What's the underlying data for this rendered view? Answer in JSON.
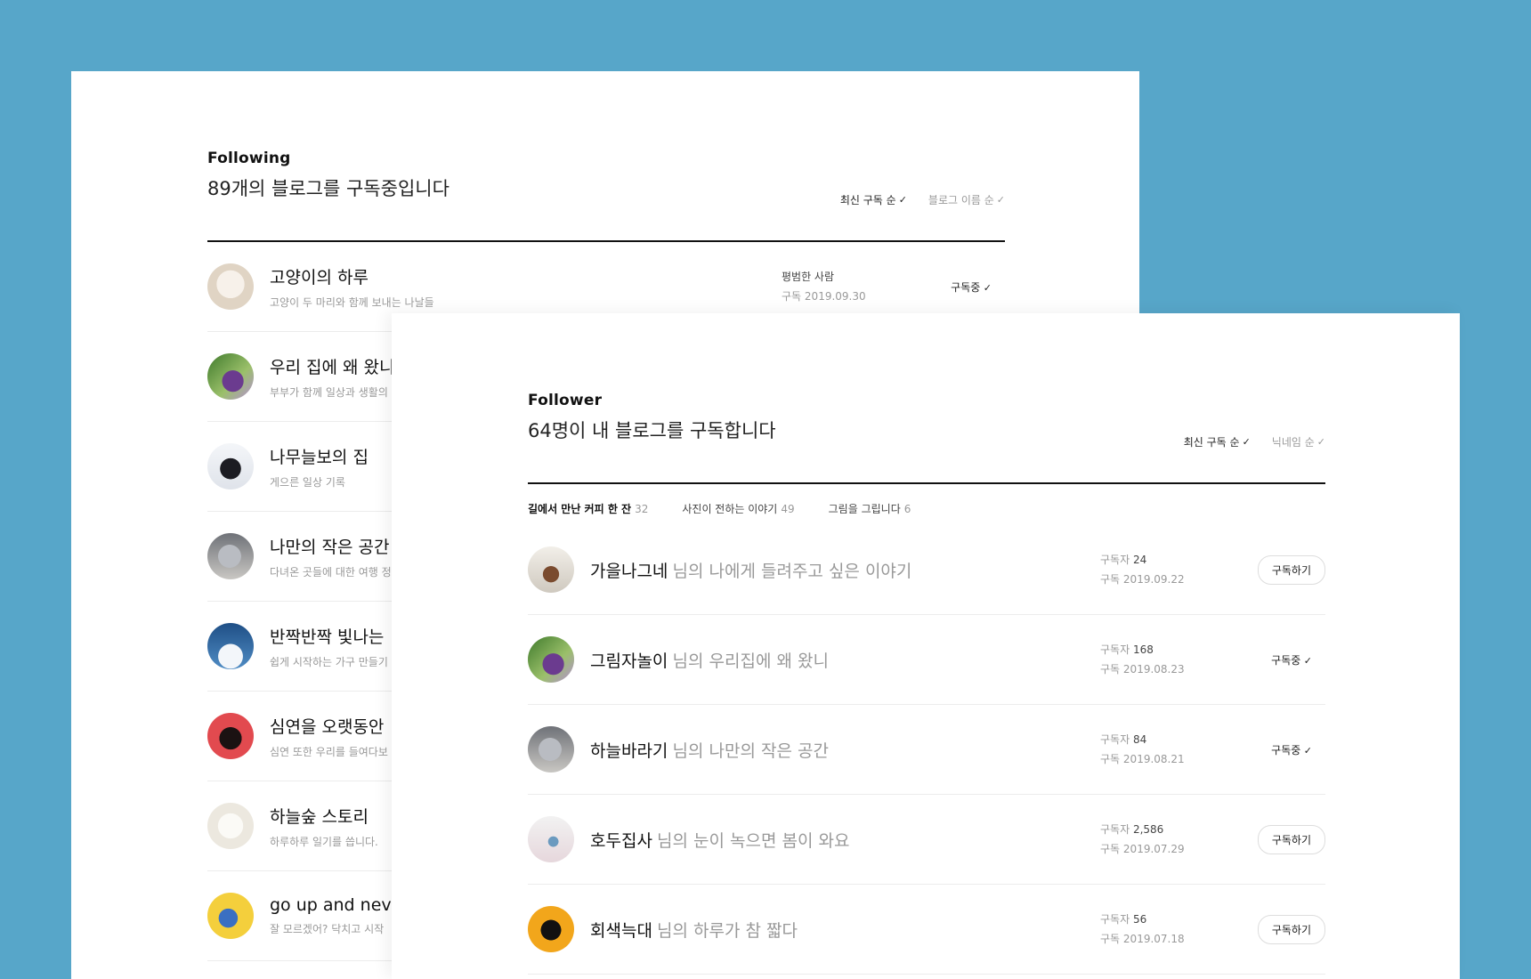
{
  "following": {
    "label": "Following",
    "headline": "89개의 블로그를 구독중입니다",
    "sort": {
      "active": "최신 구독 순",
      "inactive": "블로그 이름 순"
    },
    "items": [
      {
        "avatar": "cat-icon",
        "title": "고양이의 하루",
        "desc": "고양이 두 마리와 함께 보내는 나날들",
        "owner": "평범한 사람",
        "date_label": "구독",
        "date": "2019.09.30",
        "action": "구독중"
      },
      {
        "avatar": "grape-icon",
        "title": "우리 집에 왜 왔니",
        "desc": "부부가 함께 일상과 생활의"
      },
      {
        "avatar": "dog-icon",
        "title": "나무늘보의 집",
        "desc": "게으른 일상 기록"
      },
      {
        "avatar": "cat-icon",
        "title": "나만의 작은 공간",
        "desc": "다녀온 곳들에 대한 여행 정"
      },
      {
        "avatar": "cloud-icon",
        "title": "반짝반짝 빛나는",
        "desc": "쉽게 시작하는 가구 만들기"
      },
      {
        "avatar": "dog-icon",
        "title": "심연을 오랫동안",
        "desc": "심연 또한 우리를 들여다보"
      },
      {
        "avatar": "puppy-icon",
        "title": "하늘숲 스토리",
        "desc": "하루하루 일기를 씁니다."
      },
      {
        "avatar": "boy-icon",
        "title": "go up and never",
        "desc": "잘 모르겠어? 닥치고 시작"
      }
    ]
  },
  "follower": {
    "label": "Follower",
    "headline": "64명이 내 블로그를 구독합니다",
    "sort": {
      "active": "최신 구독 순",
      "inactive": "닉네임 순"
    },
    "tabs": [
      {
        "label": "길에서 만난 커피 한 잔",
        "count": "32"
      },
      {
        "label": "사진이 전하는 이야기",
        "count": "49"
      },
      {
        "label": "그림을 그립니다",
        "count": "6"
      }
    ],
    "items": [
      {
        "avatar": "heart-icon",
        "name": "가을나그네",
        "suffix": "님의 나에게 들려주고 싶은 이야기",
        "subs_label": "구독자",
        "subs": "24",
        "date_label": "구독",
        "date": "2019.09.22",
        "action": "구독하기",
        "subscribed": false
      },
      {
        "avatar": "grape-icon",
        "name": "그림자놀이",
        "suffix": "님의 우리집에 왜 왔니",
        "subs_label": "구독자",
        "subs": "168",
        "date_label": "구독",
        "date": "2019.08.23",
        "action": "구독중",
        "subscribed": true
      },
      {
        "avatar": "cat-icon",
        "name": "하늘바라기",
        "suffix": "님의 나만의 작은 공간",
        "subs_label": "구독자",
        "subs": "84",
        "date_label": "구독",
        "date": "2019.08.21",
        "action": "구독중",
        "subscribed": true
      },
      {
        "avatar": "person-icon",
        "name": "호두집사",
        "suffix": "님의 눈이 녹으면 봄이 와요",
        "subs_label": "구독자",
        "subs": "2,586",
        "date_label": "구독",
        "date": "2019.07.29",
        "action": "구독하기",
        "subscribed": false
      },
      {
        "avatar": "camera-icon",
        "name": "회색늑대",
        "suffix": "님의 하루가 참 짧다",
        "subs_label": "구독자",
        "subs": "56",
        "date_label": "구독",
        "date": "2019.07.18",
        "action": "구독하기",
        "subscribed": false
      }
    ]
  }
}
